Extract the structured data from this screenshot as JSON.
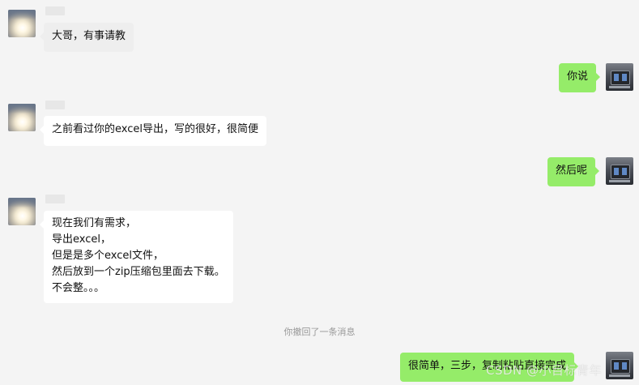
{
  "messages": [
    {
      "side": "left",
      "text": "大哥，有事请教"
    },
    {
      "side": "right",
      "text": "你说"
    },
    {
      "side": "left",
      "text": "之前看过你的excel导出，写的很好，很简便"
    },
    {
      "side": "right",
      "text": "然后呢"
    },
    {
      "side": "left",
      "lines": [
        "现在我们有需求，",
        "导出excel，",
        "但是是多个excel文件，",
        "然后放到一个zip压缩包里面去下载。",
        "不会整。。。"
      ]
    },
    {
      "side": "right",
      "text": "很简单，三步，复制粘贴直接完成"
    }
  ],
  "system_notice": "你撤回了一条消息",
  "watermark": "CSDN @小目标青年",
  "colors": {
    "chat_background": "#f4f4f4",
    "received_bubble": "#ffffff",
    "sent_bubble": "#95ec69",
    "system_text": "#999999"
  }
}
